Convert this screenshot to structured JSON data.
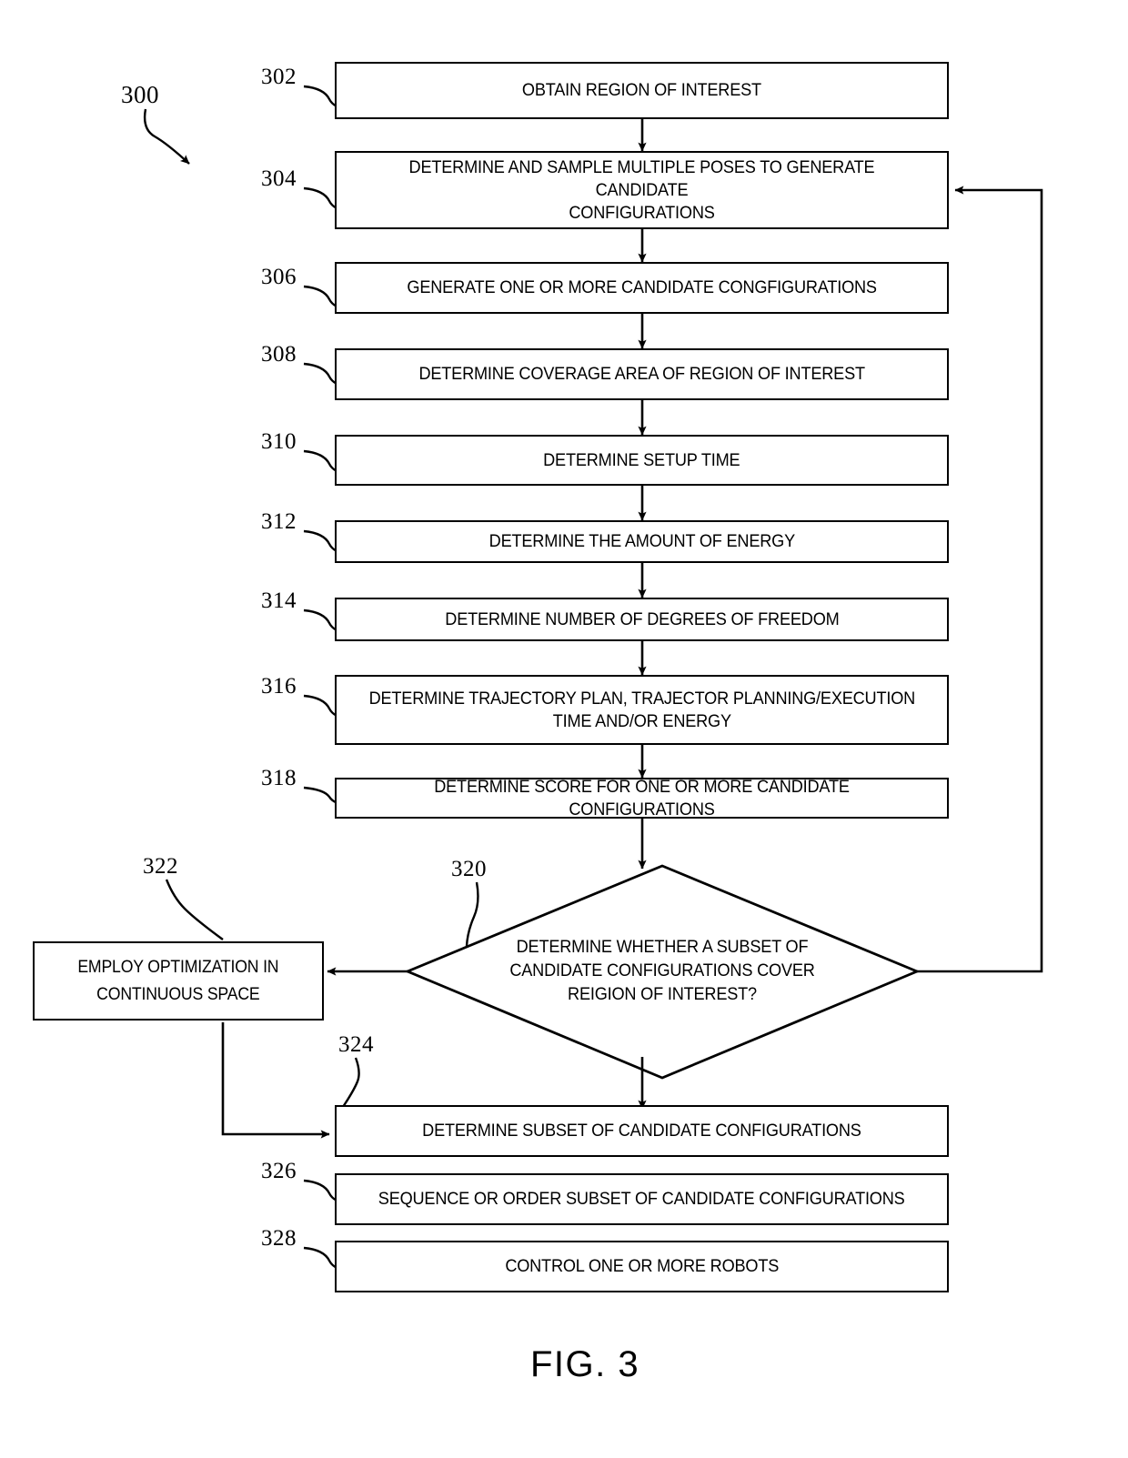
{
  "figure": {
    "caption": "FIG. 3",
    "diagram_ref": "300"
  },
  "nodes": [
    {
      "ref": "302",
      "shape": "process",
      "text": "OBTAIN REGION OF INTEREST"
    },
    {
      "ref": "304",
      "shape": "process",
      "text": "DETERMINE AND SAMPLE MULTIPLE  POSES TO GENERATE CANDIDATE\nCONFIGURATIONS"
    },
    {
      "ref": "306",
      "shape": "process",
      "text": "GENERATE ONE OR MORE CANDIDATE CONGFIGURATIONS"
    },
    {
      "ref": "308",
      "shape": "process",
      "text": "DETERMINE COVERAGE AREA OF REGION OF INTEREST"
    },
    {
      "ref": "310",
      "shape": "process",
      "text": "DETERMINE SETUP TIME"
    },
    {
      "ref": "312",
      "shape": "process",
      "text": "DETERMINE THE AMOUNT OF ENERGY"
    },
    {
      "ref": "314",
      "shape": "process",
      "text": "DETERMINE NUMBER OF DEGREES OF FREEDOM"
    },
    {
      "ref": "316",
      "shape": "process",
      "text": "DETERMINE TRAJECTORY PLAN, TRAJECTOR PLANNING/EXECUTION\nTIME AND/OR ENERGY"
    },
    {
      "ref": "318",
      "shape": "process",
      "text": "DETERMINE SCORE FOR ONE OR MORE CANDIDATE CONFIGURATIONS"
    },
    {
      "ref": "320",
      "shape": "decision",
      "text": "DETERMINE WHETHER  A SUBSET OF\nCANDIDATE CONFIGURATIONS COVER\nREIGION OF INTEREST?"
    },
    {
      "ref": "322",
      "shape": "process",
      "text": "EMPLOY OPTIMIZATION IN\nCONTINUOUS SPACE"
    },
    {
      "ref": "324",
      "shape": "process",
      "text": "DETERMINE SUBSET OF CANDIDATE CONFIGURATIONS"
    },
    {
      "ref": "326",
      "shape": "process",
      "text": "SEQUENCE OR ORDER SUBSET OF CANDIDATE CONFIGURATIONS"
    },
    {
      "ref": "328",
      "shape": "process",
      "text": "CONTROL ONE OR MORE ROBOTS"
    }
  ],
  "style": {
    "line_color": "#000000",
    "fill_color": "#ffffff"
  }
}
